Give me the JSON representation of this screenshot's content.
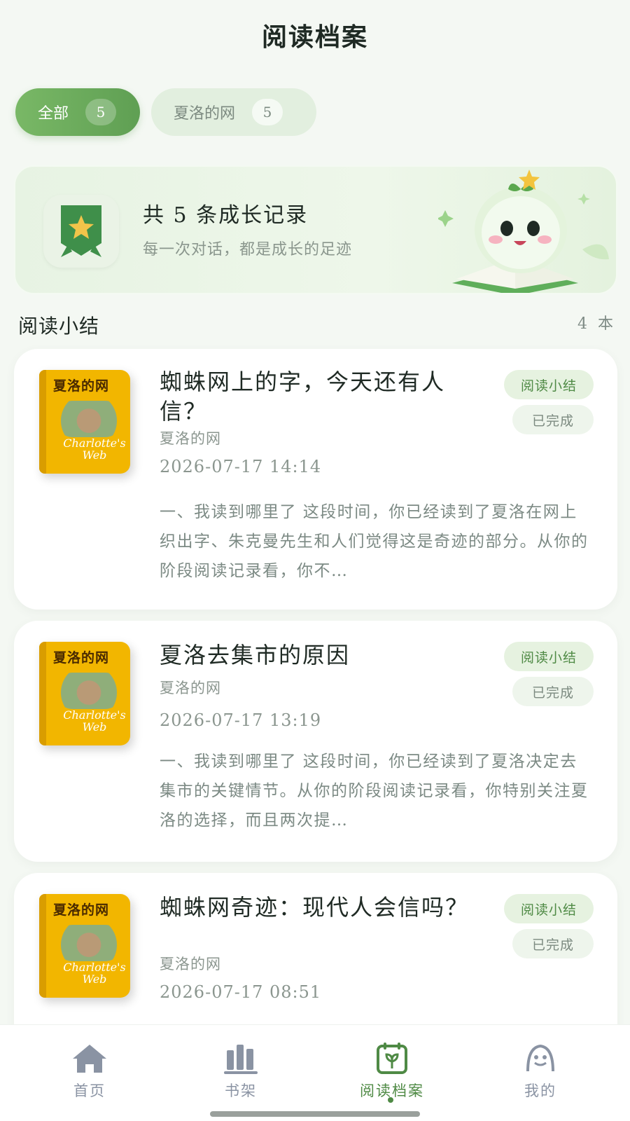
{
  "header": {
    "title": "阅读档案"
  },
  "filters": [
    {
      "label": "全部",
      "count": "5",
      "active": true
    },
    {
      "label": "夏洛的网",
      "count": "5",
      "active": false
    }
  ],
  "banner": {
    "title": "共 5 条成长记录",
    "subtitle": "每一次对话，都是成长的足迹",
    "icon": "star-badge-icon"
  },
  "section": {
    "title": "阅读小结",
    "count": "4 本"
  },
  "cards": [
    {
      "cover_title": "夏洛的网",
      "cover_en": "Charlotte's Web",
      "title": "蜘蛛网上的字，今天还有人信？",
      "book": "夏洛的网",
      "date": "2026-07-17 14:14",
      "excerpt": "一、我读到哪里了 这段时间，你已经读到了夏洛在网上织出字、朱克曼先生和人们觉得这是奇迹的部分。从你的阶段阅读记录看，你不…",
      "tag_type": "阅读小结",
      "tag_status": "已完成"
    },
    {
      "cover_title": "夏洛的网",
      "cover_en": "Charlotte's Web",
      "title": "夏洛去集市的原因",
      "book": "夏洛的网",
      "date": "2026-07-17 13:19",
      "excerpt": "一、我读到哪里了 这段时间，你已经读到了夏洛决定去集市的关键情节。从你的阶段阅读记录看，你特别关注夏洛的选择，而且两次提…",
      "tag_type": "阅读小结",
      "tag_status": "已完成"
    },
    {
      "cover_title": "夏洛的网",
      "cover_en": "Charlotte's Web",
      "title": "蜘蛛网奇迹：现代人会信吗？",
      "book": "夏洛的网",
      "date": "2026-07-17 08:51",
      "excerpt": "",
      "tag_type": "阅读小结",
      "tag_status": "已完成"
    }
  ],
  "nav": [
    {
      "label": "首页",
      "icon": "home-icon",
      "active": false
    },
    {
      "label": "书架",
      "icon": "bookshelf-icon",
      "active": false
    },
    {
      "label": "阅读档案",
      "icon": "reading-record-icon",
      "active": true
    },
    {
      "label": "我的",
      "icon": "profile-icon",
      "active": false
    }
  ],
  "colors": {
    "accent": "#5f9f53",
    "background": "#f4f8f3",
    "muted": "#8a93a3"
  }
}
